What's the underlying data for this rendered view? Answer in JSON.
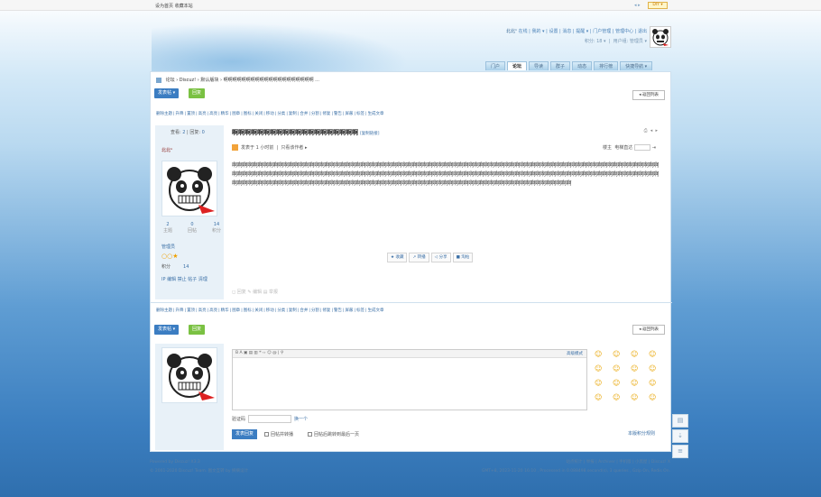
{
  "topbar": {
    "set_home": "设为首页",
    "favorite": "收藏本站",
    "switch": "◂ ▸",
    "diy": "DIY ▾"
  },
  "user": {
    "name": "北北ⁿ",
    "status": "在线",
    "my": "我的 ▾",
    "settings": "设置",
    "messages": "消息",
    "remind": "提醒 ▾",
    "portal_mgmt": "门户管理",
    "admin_center": "管理中心",
    "logout": "退出",
    "credits": "积分: 18 ▾",
    "group": "用户组: 管理员 ▾"
  },
  "nav": [
    "门户",
    "论坛",
    "导读",
    "群子",
    "动态",
    "排行榜",
    "快捷导航 ▾"
  ],
  "breadcrumb": [
    "论坛",
    "Discuz!",
    "默认版块",
    "啊啊啊啊啊啊啊啊啊啊啊啊啊啊啊啊啊啊啊啊 ..."
  ],
  "buttons": {
    "post": "发表帖 ▾",
    "reply": "回复",
    "back": "◂ 返回列表",
    "submit": "发表回复"
  },
  "mod_ops": [
    "删除主题",
    "升降",
    "置顶",
    "高亮",
    "高亮",
    "精华",
    "图章",
    "图标",
    "关闭",
    "移动",
    "分类",
    "复制",
    "合并",
    "分割",
    "修复",
    "警告",
    "屏蔽",
    "标签",
    "生成文章"
  ],
  "thread": {
    "views_label": "查看:",
    "views": "2",
    "replies_label": "回复:",
    "replies": "0",
    "title": "啊啊啊啊啊啊啊啊啊啊啊啊啊啊啊啊啊啊啊啊",
    "copy_link": "[复制链接]",
    "posted": "发表于 1 小时前",
    "only_author": "只看该作者 ▸",
    "floor": "楼主",
    "jump": "电梯直达",
    "content": "啊啊啊啊啊啊啊啊啊啊啊啊啊啊啊啊啊啊啊啊啊啊啊啊啊啊啊啊啊啊啊啊啊啊啊啊啊啊啊啊啊啊啊啊啊啊啊啊啊啊啊啊啊啊啊啊啊啊啊啊啊啊啊啊啊啊啊啊啊啊啊啊啊啊啊啊啊啊啊啊啊啊啊啊啊啊啊啊啊啊啊啊啊啊啊啊啊啊啊啊啊啊啊啊啊啊啊啊啊啊啊啊啊啊啊啊啊啊啊啊啊啊啊啊啊啊啊啊啊啊啊啊啊啊啊啊啊啊啊啊啊啊啊啊啊啊啊啊啊啊啊啊啊啊啊啊啊啊啊啊啊啊啊啊啊啊啊啊啊啊啊啊啊啊啊啊啊啊啊啊啊啊啊啊啊啊啊啊啊啊啊啊啊啊啊啊啊啊啊啊啊啊啊啊啊啊啊啊啊啊啊啊啊啊啊啊啊啊啊啊啊啊啊啊啊啊啊啊啊啊啊啊"
  },
  "author": {
    "name": "北北ⁿ",
    "themes": "2",
    "posts": "0",
    "credits": "14",
    "themes_label": "主题",
    "posts_label": "回帖",
    "credits_label": "积分",
    "role": "管理员",
    "stars": "○○★",
    "pts_label": "积分",
    "pts": "14",
    "admin_links": "IP  编辑  禁止  帖子  清理"
  },
  "actions": [
    "★ 收藏",
    "↗ 转播",
    "◁ 分享",
    "■ 淘帖"
  ],
  "post_ops": "◻ 回复   ✎ 编辑   ▤ 举报",
  "editor": {
    "tools": "B  A  ▣  ▤  ▥  ❝  ‹›  ☺  @  |  ⚲",
    "advanced": "高级模式"
  },
  "smilies": [
    "☺",
    "☺",
    "☺",
    "☺",
    "☺",
    "☺",
    "☺",
    "☺",
    "☺",
    "☺",
    "☺",
    "☺",
    "☺",
    "☺",
    "☺",
    "☺"
  ],
  "verify": {
    "label": "验证码",
    "refresh": "换一个"
  },
  "options": {
    "forward": "回帖并转播",
    "to_last": "回帖后跳转到最后一页",
    "rules": "本版积分规则"
  },
  "footer": {
    "powered": "Powered by Discuz! X3.3",
    "copyright": "© 2001-2020 Discuz! Team. 图文互转 by 摘摘设计",
    "links": "站点统计  |  举报  |  Archiver  |  手机版  |  小黑屋  |  Discuz! X",
    "gmt": "GMT+8, 2023-11-20 16:10 , Processed in 0.088498 second(s), 3 queries , Gzip On, Redis On."
  },
  "rail": [
    "▤",
    "⇣",
    "≡"
  ]
}
